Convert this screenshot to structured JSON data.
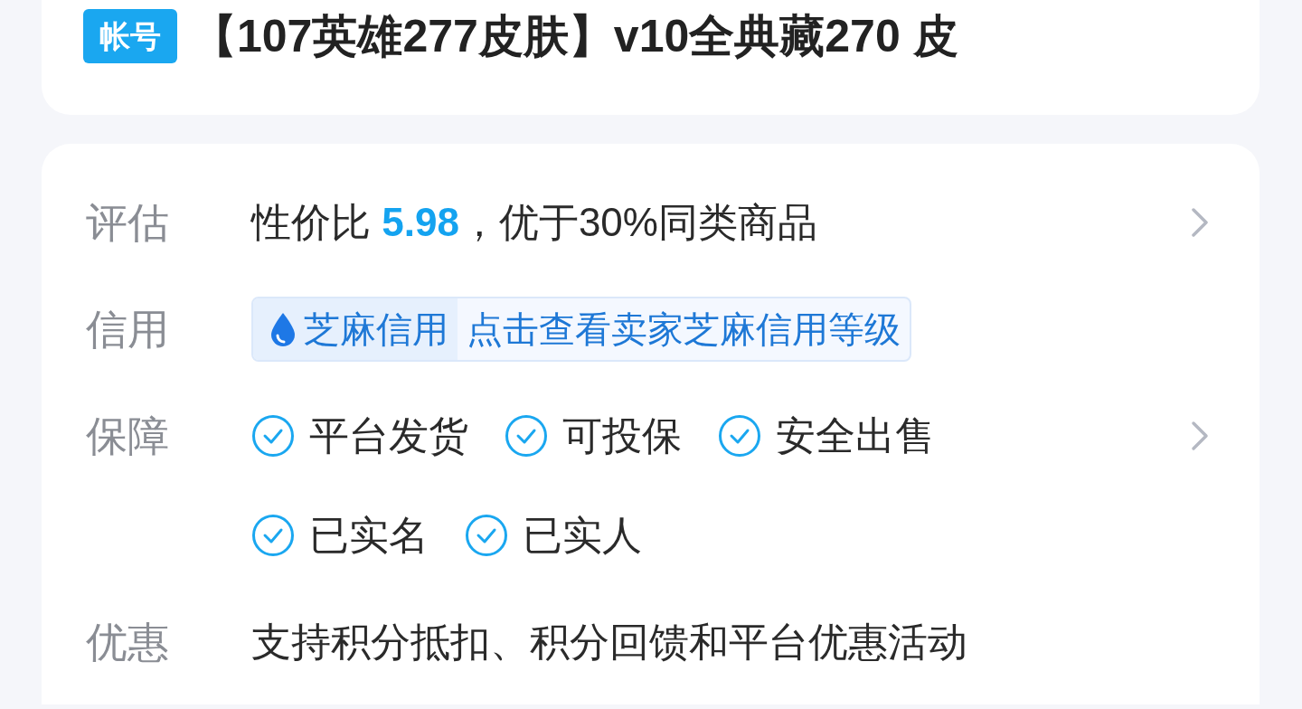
{
  "header": {
    "tag": "帐号",
    "title": "【107英雄277皮肤】v10全典藏270 皮"
  },
  "details": [
    {
      "kind": "rating",
      "label": "评估",
      "prefix": "性价比 ",
      "score": "5.98",
      "suffix": "，优于30%同类商品",
      "arrow": true
    },
    {
      "kind": "credit",
      "label": "信用",
      "brand": "芝麻信用",
      "link": "点击查看卖家芝麻信用等级",
      "arrow": false
    },
    {
      "kind": "guarantee",
      "label": "保障",
      "items": [
        "平台发货",
        "可投保",
        "安全出售",
        "已实名",
        "已实人"
      ],
      "arrow": true
    },
    {
      "kind": "text",
      "label": "优惠",
      "text": "支持积分抵扣、积分回馈和平台优惠活动",
      "arrow": false
    }
  ]
}
